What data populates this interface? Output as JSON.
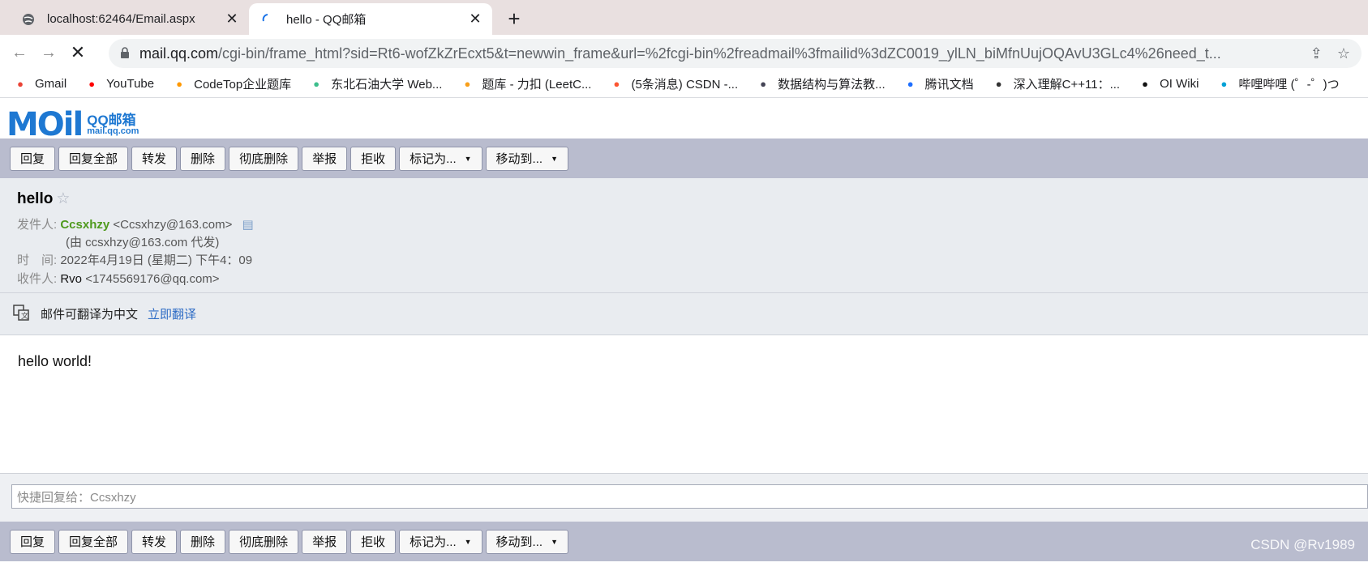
{
  "browser": {
    "tabs": [
      {
        "title": "localhost:62464/Email.aspx",
        "active": false
      },
      {
        "title": "hello - QQ邮箱",
        "active": true
      }
    ],
    "url_host": "mail.qq.com",
    "url_path": "/cgi-bin/frame_html?sid=Rt6-wofZkZrEcxt5&t=newwin_frame&url=%2fcgi-bin%2freadmail%3fmailid%3dZC0019_ylLN_biMfnUujOQAvU3GLc4%26need_t...",
    "bookmarks": [
      {
        "label": "Gmail",
        "icon": "gmail-icon",
        "color": "#ea4335"
      },
      {
        "label": "YouTube",
        "icon": "youtube-icon",
        "color": "#ff0000"
      },
      {
        "label": "CodeTop企业题库",
        "icon": "codetop-icon",
        "color": "#ff9800"
      },
      {
        "label": "东北石油大学 Web...",
        "icon": "lock-bookmark-icon",
        "color": "#3dbe8c"
      },
      {
        "label": "题库 - 力扣 (LeetC...",
        "icon": "leetcode-icon",
        "color": "#f89f1b"
      },
      {
        "label": "(5条消息) CSDN -...",
        "icon": "csdn-icon",
        "color": "#fc5531"
      },
      {
        "label": "数据结构与算法教...",
        "icon": "algo-icon",
        "color": "#445"
      },
      {
        "label": "腾讯文档",
        "icon": "tencent-docs-icon",
        "color": "#1e6fff"
      },
      {
        "label": "深入理解C++11：...",
        "icon": "globe-icon",
        "color": "#333"
      },
      {
        "label": "OI Wiki",
        "icon": "oiwiki-icon",
        "color": "#111"
      },
      {
        "label": "哔哩哔哩 (゜-゜)つ",
        "icon": "bilibili-icon",
        "color": "#00a1d6"
      }
    ]
  },
  "logo": {
    "moil": "MOil",
    "qq": "QQ邮箱",
    "domain": "mail.qq.com"
  },
  "toolbar": {
    "reply": "回复",
    "reply_all": "回复全部",
    "forward": "转发",
    "delete": "删除",
    "delete_forever": "彻底删除",
    "report": "举报",
    "reject": "拒收",
    "mark_as": "标记为...",
    "move_to": "移动到..."
  },
  "mail": {
    "subject": "hello",
    "from_label": "发件人:",
    "from_name": "Ccsxhzy",
    "from_addr": "<Ccsxhzy@163.com>",
    "proxy_note": "(由 ccsxhzy@163.com 代发)",
    "time_label": "时　间:",
    "time_value": "2022年4月19日 (星期二) 下午4：09",
    "to_label": "收件人:",
    "to_name": "Rvo",
    "to_addr": "<1745569176@qq.com>",
    "translate_text": "邮件可翻译为中文",
    "translate_link": "立即翻译",
    "body": "hello world!"
  },
  "quick_reply": {
    "placeholder": "快捷回复给：Ccsxhzy"
  },
  "watermark": "CSDN @Rv1989"
}
